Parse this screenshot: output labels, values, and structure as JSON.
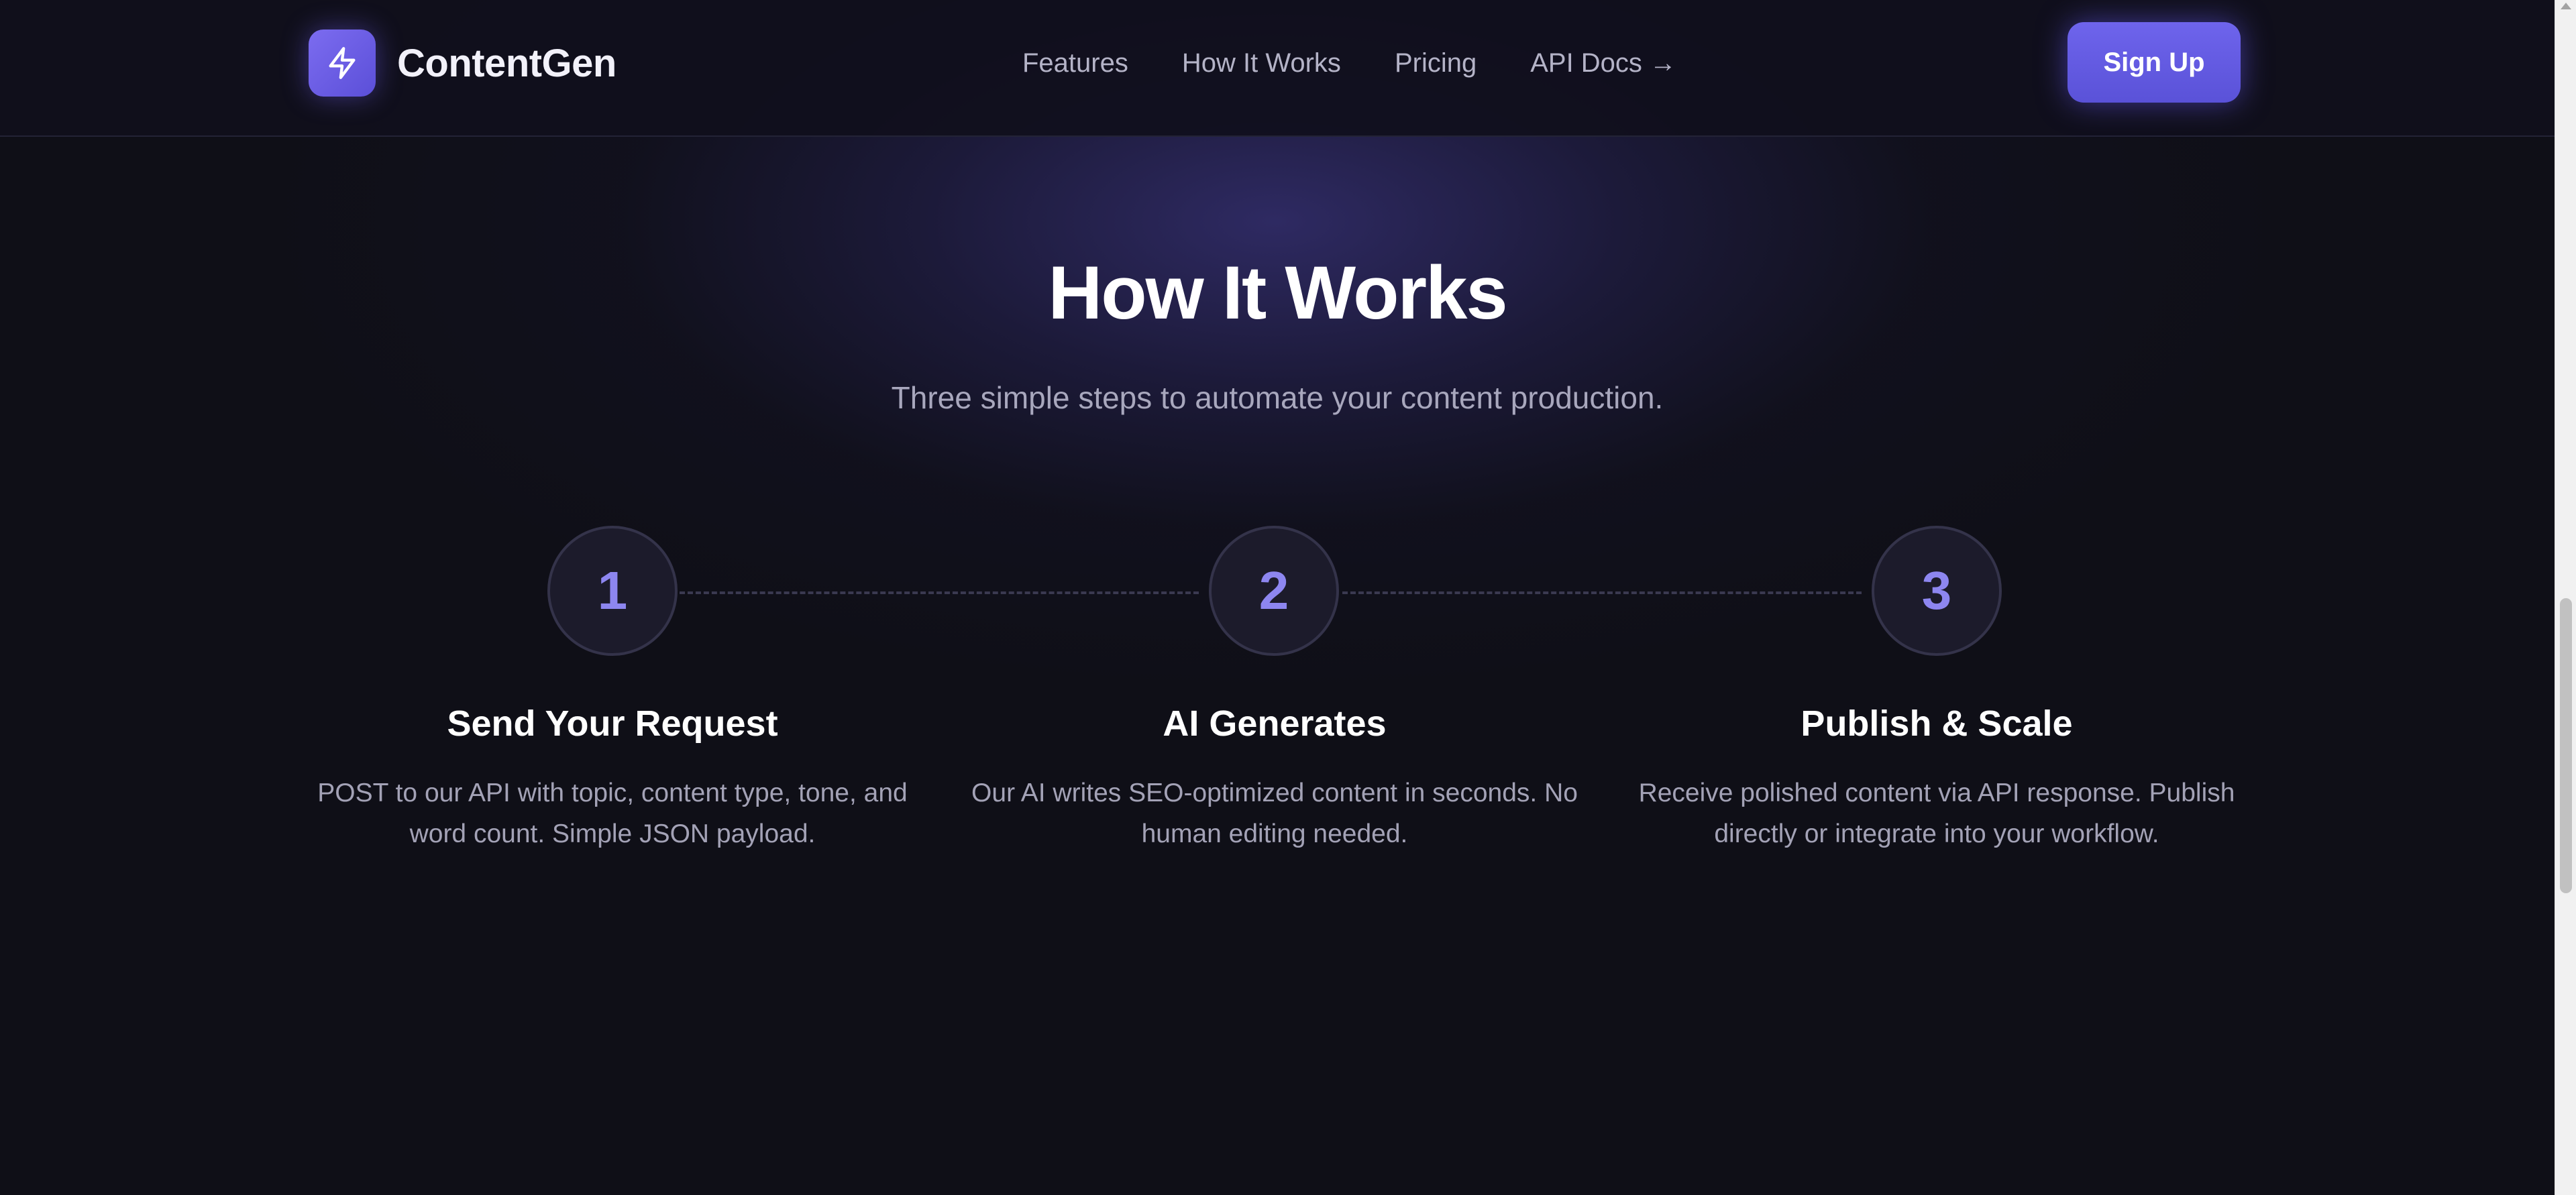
{
  "brand": {
    "name": "ContentGen",
    "icon": "lightning-icon",
    "accent": "#6e64ec"
  },
  "nav": {
    "links": [
      {
        "label": "Features"
      },
      {
        "label": "How It Works"
      },
      {
        "label": "Pricing"
      },
      {
        "label": "API Docs →"
      }
    ],
    "signup_label": "Sign Up"
  },
  "section": {
    "title": "How It Works",
    "subtitle": "Three simple steps to automate your content production."
  },
  "steps": [
    {
      "number": "1",
      "title": "Send Your Request",
      "description": "POST to our API with topic, content type, tone, and word count. Simple JSON payload."
    },
    {
      "number": "2",
      "title": "AI Generates",
      "description": "Our AI writes SEO-optimized content in seconds. No human editing needed."
    },
    {
      "number": "3",
      "title": "Publish & Scale",
      "description": "Receive polished content via API response. Publish directly or integrate into your workflow."
    }
  ]
}
